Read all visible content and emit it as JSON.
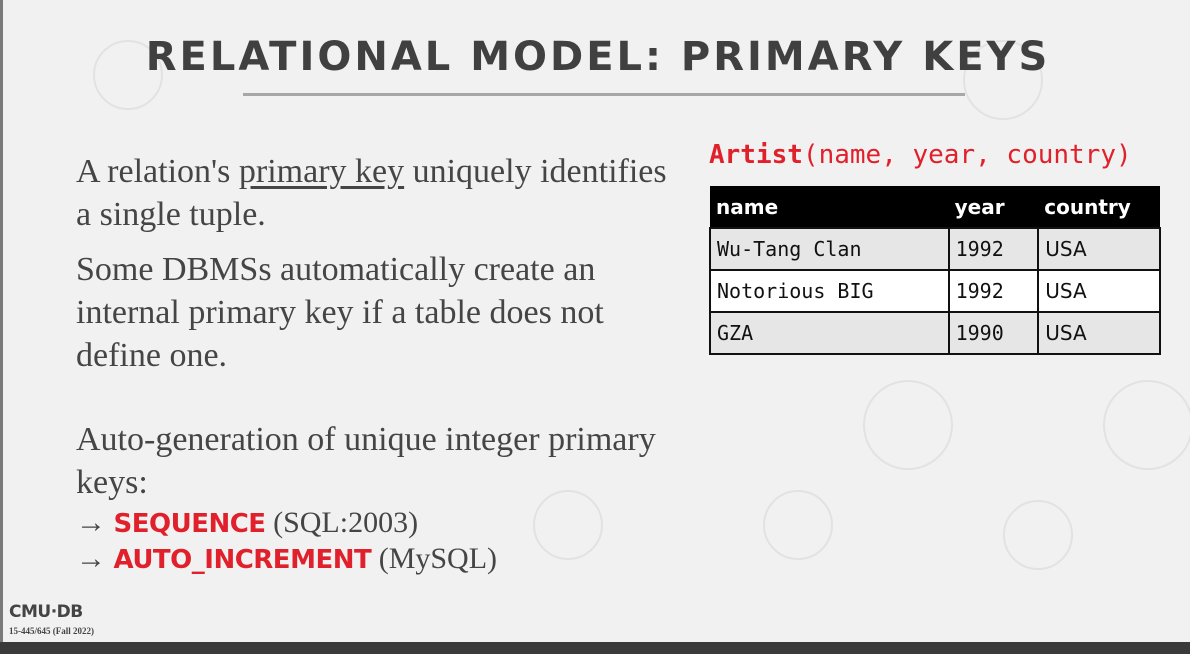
{
  "title": "RELATIONAL MODEL: PRIMARY KEYS",
  "paragraph1": {
    "before": "A relation's ",
    "underlined": "primary key",
    "after": " uniquely identifies a single tuple."
  },
  "paragraph2": "Some DBMSs automatically create an internal primary key if a table does not define one.",
  "paragraph3": "Auto-generation of unique integer primary keys:",
  "bullets": [
    {
      "arrow": "→",
      "keyword": "SEQUENCE",
      "note": " (SQL:2003)"
    },
    {
      "arrow": "→",
      "keyword": "AUTO_INCREMENT",
      "note": " (MySQL)"
    }
  ],
  "schema": {
    "name": "Artist",
    "attrs": "(name, year, country)"
  },
  "table": {
    "headers": [
      "name",
      "year",
      "country"
    ],
    "rows": [
      [
        "Wu-Tang Clan",
        "1992",
        "USA"
      ],
      [
        "Notorious BIG",
        "1992",
        "USA"
      ],
      [
        "GZA",
        "1990",
        "USA"
      ]
    ]
  },
  "footer": {
    "logo": "CMU·DB",
    "course": "15-445/645 (Fall 2022)"
  },
  "colors": {
    "accent": "#e0202a",
    "text": "#454545",
    "background": "#f1f1f1"
  }
}
